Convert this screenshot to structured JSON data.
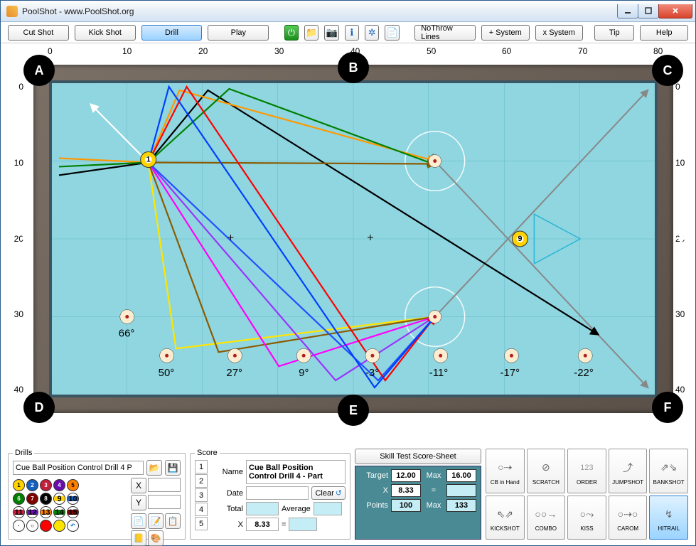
{
  "window": {
    "title": "PoolShot - www.PoolShot.org"
  },
  "toolbar": {
    "cut_shot": "Cut Shot",
    "kick_shot": "Kick Shot",
    "drill": "Drill",
    "play": "Play",
    "no_throw": "NoThrow Lines",
    "plus_sys": "+ System",
    "x_sys": "x System",
    "tip": "Tip",
    "help": "Help"
  },
  "ruler_h": [
    "0",
    "10",
    "20",
    "30",
    "40",
    "50",
    "60",
    "70",
    "80"
  ],
  "ruler_v": [
    "0",
    "10",
    "20",
    "30",
    "40"
  ],
  "pockets": {
    "A": "A",
    "B": "B",
    "C": "C",
    "D": "D",
    "E": "E",
    "F": "F"
  },
  "angle_labels": [
    "66°",
    "50°",
    "27°",
    "9°",
    "-3°",
    "-11°",
    "-17°",
    "-22°"
  ],
  "drills": {
    "legend": "Drills",
    "name": "Cue Ball Position Control Drill 4 P",
    "x": "X",
    "y": "Y"
  },
  "score": {
    "legend": "Score",
    "nums": [
      "1",
      "2",
      "3",
      "4",
      "5"
    ],
    "name_lbl": "Name",
    "name_val": "Cue Ball Position Control Drill 4 - Part",
    "date_lbl": "Date",
    "date_val": "",
    "clear": "Clear",
    "total_lbl": "Total",
    "total_val": "",
    "avg_lbl": "Average",
    "avg_val": "",
    "x_lbl": "X",
    "x_val": "8.33",
    "eq": "="
  },
  "skill": {
    "btn": "Skill Test Score-Sheet",
    "target_lbl": "Target",
    "target_val": "12.00",
    "max_lbl": "Max",
    "max_val": "16.00",
    "x_lbl": "X",
    "x_val": "8.33",
    "eq": "=",
    "pts_lbl": "Points",
    "pts_val": "100",
    "pts_max": "133"
  },
  "modes": [
    "CB in Hand",
    "SCRATCH",
    "ORDER",
    "JUMPSHOT",
    "BANKSHOT",
    "KICKSHOT",
    "COMBO",
    "KISS",
    "CAROM",
    "HITRAIL"
  ]
}
